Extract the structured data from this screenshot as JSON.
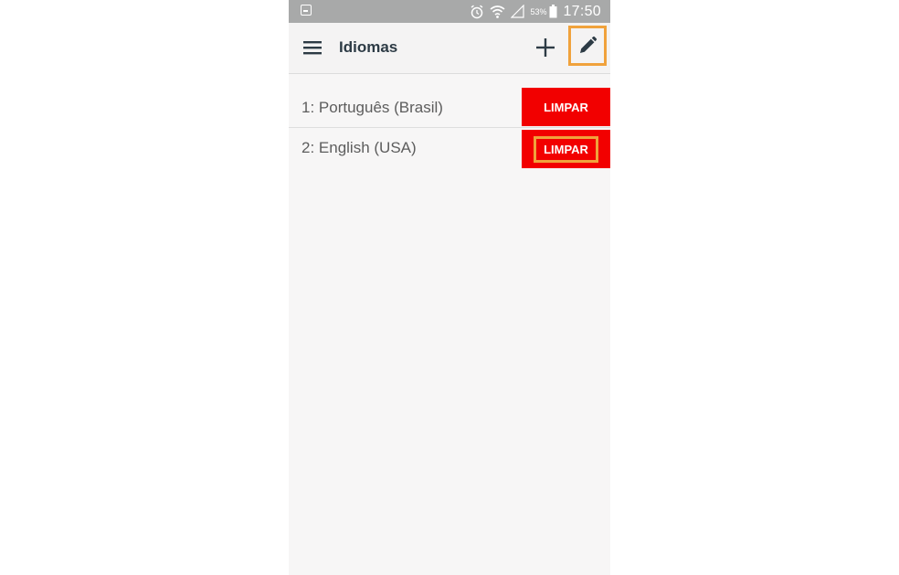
{
  "status_bar": {
    "battery_percent": "53%",
    "time": "17:50",
    "icons": [
      "notification-icon",
      "alarm-icon",
      "wifi-icon",
      "signal-icon",
      "battery-icon"
    ]
  },
  "app_bar": {
    "title": "Idiomas",
    "menu_icon": "hamburger-menu-icon",
    "add_icon": "plus-icon",
    "edit_icon": "pencil-icon"
  },
  "languages": [
    {
      "label": "1: Português (Brasil)",
      "action": "LIMPAR"
    },
    {
      "label": "2: English (USA)",
      "action": "LIMPAR"
    }
  ],
  "colors": {
    "status_bar": "#a8a9a9",
    "app_bar": "#f4f3f3",
    "background": "#f7f6f6",
    "clear_button": "#f20000",
    "highlight": "#f0a23c",
    "title_text": "#2d3b45"
  }
}
